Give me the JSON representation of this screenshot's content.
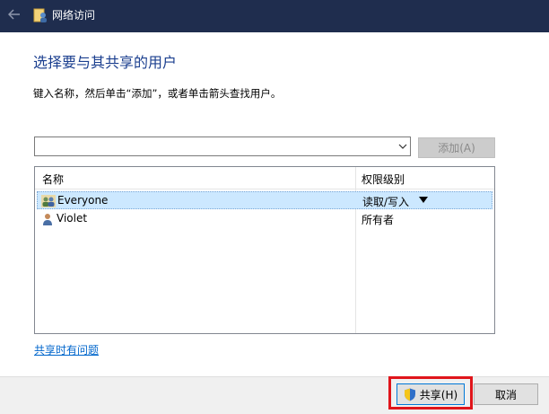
{
  "window": {
    "title": "网络访问"
  },
  "heading": "选择要与其共享的用户",
  "instructions": "键入名称，然后单击“添加”，或者单击箭头查找用户。",
  "user_input": {
    "value": "",
    "placeholder": ""
  },
  "add_button": "添加(A)",
  "table": {
    "columns": [
      "名称",
      "权限级别"
    ],
    "rows": [
      {
        "name": "Everyone",
        "permission": "读取/写入",
        "selected": true,
        "icon": "group-icon"
      },
      {
        "name": "Violet",
        "permission": "所有者",
        "selected": false,
        "icon": "user-icon"
      }
    ]
  },
  "help_link": "共享时有问题",
  "footer": {
    "share_button": "共享(H)",
    "cancel_button": "取消"
  },
  "colors": {
    "titlebar": "#1f2d4e",
    "heading": "#1b3f8f",
    "link": "#0066cc",
    "selection": "#cce8ff",
    "highlight": "#e0151b"
  }
}
